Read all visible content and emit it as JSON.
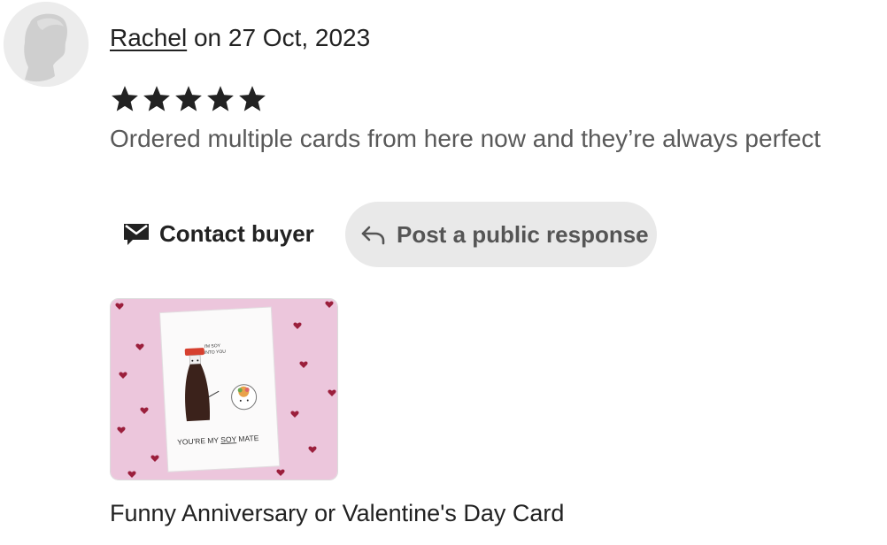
{
  "review": {
    "reviewer_name": "Rachel",
    "date_text": " on 27 Oct, 2023",
    "rating": 5,
    "rating_max": 5,
    "text": "Ordered multiple cards from here now and they’re always perfect"
  },
  "actions": {
    "contact_label": "Contact buyer",
    "respond_label": "Post a public response"
  },
  "product": {
    "card_lines": {
      "speech_line1": "I'M SOY",
      "speech_line2": "INTO YOU",
      "bottom_prefix": "YOU'RE MY ",
      "bottom_soy": "SOY",
      "bottom_suffix": " MATE"
    },
    "title": "Funny Anniversary or Valentine's Day Card"
  },
  "colors": {
    "star": "#222222",
    "button_bg": "#e9e9e9",
    "thumb_bg": "#ecc6dc",
    "heart": "#9b1f3c",
    "soy_cap": "#d6402f"
  },
  "icons": {
    "avatar": "default-person-avatar",
    "contact": "envelope-icon",
    "respond": "reply-arrow-icon",
    "rating": "star-icon"
  }
}
